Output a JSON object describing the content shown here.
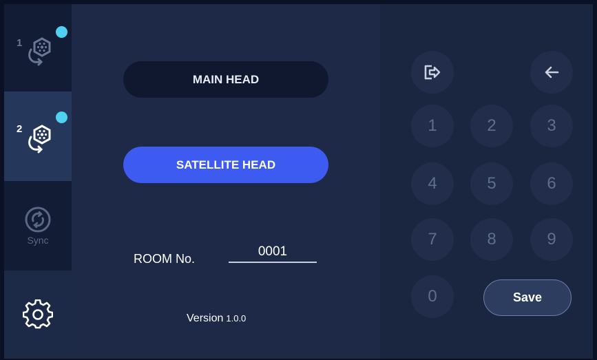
{
  "sidebar": {
    "items": [
      {
        "id": "head-1",
        "number": "1",
        "icon": "hand-hex-icon",
        "has_indicator": true,
        "active": false
      },
      {
        "id": "head-2",
        "number": "2",
        "icon": "hand-hex-icon",
        "has_indicator": true,
        "active": true
      },
      {
        "id": "sync",
        "label": "Sync",
        "icon": "sync-icon",
        "active": false
      },
      {
        "id": "settings",
        "icon": "gear-icon",
        "active": false
      }
    ]
  },
  "mode": {
    "main_label": "MAIN HEAD",
    "satellite_label": "SATELLITE HEAD",
    "selected": "satellite"
  },
  "room": {
    "label": "ROOM No.",
    "value": "0001"
  },
  "version": {
    "label": "Version",
    "number": "1.0.0"
  },
  "keypad": {
    "exit_icon": "exit-icon",
    "backspace_icon": "backspace-arrow-icon",
    "keys": [
      "1",
      "2",
      "3",
      "4",
      "5",
      "6",
      "7",
      "8",
      "9",
      "0"
    ],
    "save_label": "Save"
  },
  "colors": {
    "accent": "#3e5bf1",
    "indicator": "#4fd1f2",
    "background": "#1d2947"
  }
}
